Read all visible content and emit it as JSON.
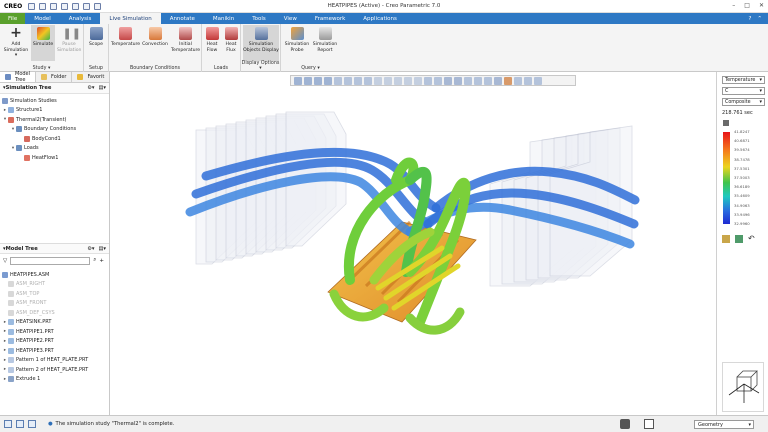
{
  "app": {
    "logo": "CREO",
    "window_title": "HEATPIPES (Active) - Creo Parametric 7.0"
  },
  "tabs": [
    "File",
    "Model",
    "Analysis",
    "Live Simulation",
    "Annotate",
    "Manikin",
    "Tools",
    "View",
    "Framework",
    "Applications"
  ],
  "active_tab": "Live Simulation",
  "ribbon": {
    "study": {
      "label": "Study",
      "buttons": [
        "Add Simulation",
        "Simulate",
        "Pause Simulation"
      ]
    },
    "setup": {
      "label": "Setup",
      "buttons": [
        "Scope"
      ]
    },
    "boundary": {
      "label": "Boundary Conditions",
      "buttons": [
        "Temperature",
        "Convection",
        "Initial Temperature"
      ]
    },
    "loads": {
      "label": "Loads",
      "buttons": [
        "Heat Flow",
        "Heat Flux"
      ]
    },
    "display": {
      "label": "Display Options",
      "buttons": [
        "Simulation Objects Display"
      ]
    },
    "query": {
      "label": "Query",
      "buttons": [
        "Simulation Probe",
        "Simulation Report"
      ]
    }
  },
  "left_panel": {
    "tabs": [
      "Model Tree",
      "Folder",
      "Favorit"
    ],
    "sim_tree_title": "Simulation Tree",
    "sim_tree": [
      "Simulation Studies",
      "Structure1",
      "Thermal2(Transient)",
      "Boundary Conditions",
      "BodyCond1",
      "Loads",
      "HeatFlow1"
    ],
    "model_tree_title": "Model Tree",
    "model_tree": [
      "HEATPIPES.ASM",
      "ASM_RIGHT",
      "ASM_TOP",
      "ASM_FRONT",
      "ASM_DEF_CSYS",
      "HEATSINK.PRT",
      "HEATPIPE1.PRT",
      "HEATPIPE2.PRT",
      "HEATPIPE3.PRT",
      "Pattern 1 of HEAT_PLATE.PRT",
      "Pattern 2 of HEAT_PLATE.PRT",
      "Extrude 1"
    ]
  },
  "right_panel": {
    "quantity": "Temperature",
    "unit": "C",
    "component": "Composite",
    "time": "218.761 sec",
    "legend": [
      "41.8247",
      "40.6871",
      "39.5674",
      "38.7478",
      "37.5301",
      "37.5003",
      "36.6189",
      "35.4609",
      "34.9063",
      "33.9496",
      "32.9960"
    ],
    "colors": {
      "max": "#e8141a",
      "mid": "#3fc44b",
      "min": "#1f2bd2"
    }
  },
  "status": {
    "message": "The simulation study \"Thermal2\" is complete.",
    "filter": "Geometry"
  },
  "colors": {
    "tabbar": "#2d78c4",
    "file_tab": "#5aa02c",
    "ribbon": "#f4f4f4"
  }
}
